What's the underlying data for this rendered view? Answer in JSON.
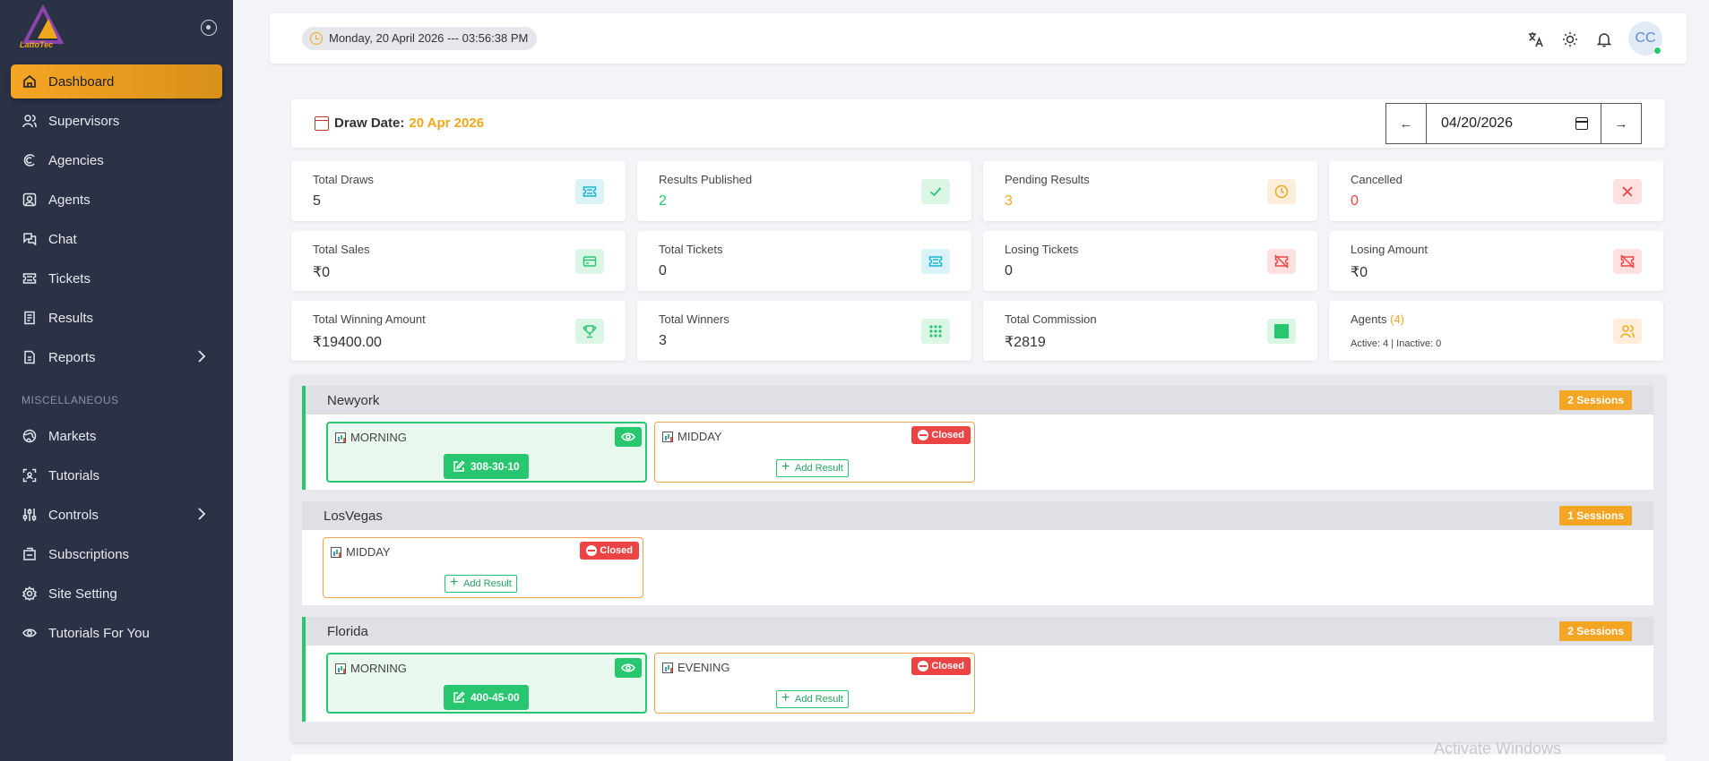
{
  "app": {
    "logo_text": "LattoTec"
  },
  "sidebar": {
    "items": [
      {
        "label": "Dashboard",
        "icon": "home-icon",
        "active": true
      },
      {
        "label": "Supervisors",
        "icon": "users-icon"
      },
      {
        "label": "Agencies",
        "icon": "agency-icon"
      },
      {
        "label": "Agents",
        "icon": "agent-icon"
      },
      {
        "label": "Chat",
        "icon": "chat-icon"
      },
      {
        "label": "Tickets",
        "icon": "ticket-icon"
      },
      {
        "label": "Results",
        "icon": "document-icon"
      },
      {
        "label": "Reports",
        "icon": "reports-icon",
        "expandable": true
      }
    ],
    "section_label": "MISCELLANEOUS",
    "misc_items": [
      {
        "label": "Markets",
        "icon": "globe-icon"
      },
      {
        "label": "Tutorials",
        "icon": "tutorial-icon"
      },
      {
        "label": "Controls",
        "icon": "sliders-icon",
        "expandable": true
      },
      {
        "label": "Subscriptions",
        "icon": "subscription-icon"
      },
      {
        "label": "Site Setting",
        "icon": "gear-icon"
      },
      {
        "label": "Tutorials For You",
        "icon": "eye-icon"
      }
    ]
  },
  "topbar": {
    "datetime": "Monday, 20 April 2026 --- 03:56:38 PM",
    "avatar_initials": "CC"
  },
  "draw": {
    "label": "Draw Date:",
    "value": "20 Apr 2026",
    "prev": "←",
    "next": "→",
    "input_value": "04/20/2026"
  },
  "stats": [
    {
      "title": "Total Draws",
      "value": "5",
      "value_color": "#333333",
      "icon": "ticket-icon",
      "badge_bg": "#d9f3f8",
      "icon_color": "#19b4d1"
    },
    {
      "title": "Results Published",
      "value": "2",
      "value_color": "#28c76f",
      "icon": "check-icon",
      "badge_bg": "#dcf6e6",
      "icon_color": "#28c76f"
    },
    {
      "title": "Pending Results",
      "value": "3",
      "value_color": "#f0a81b",
      "icon": "clock-icon",
      "badge_bg": "#fdeedb",
      "icon_color": "#f0a81b"
    },
    {
      "title": "Cancelled",
      "value": "0",
      "value_color": "#ea4444",
      "icon": "x-icon",
      "badge_bg": "#fde1e1",
      "icon_color": "#ea4444"
    },
    {
      "title": "Total Sales",
      "value": "₹0",
      "value_color": "#333333",
      "icon": "card-icon",
      "badge_bg": "#dcf6e6",
      "icon_color": "#28c76f"
    },
    {
      "title": "Total Tickets",
      "value": "0",
      "value_color": "#333333",
      "icon": "ticket-icon",
      "badge_bg": "#d9f3f8",
      "icon_color": "#19b4d1"
    },
    {
      "title": "Losing Tickets",
      "value": "0",
      "value_color": "#333333",
      "icon": "ticket-off-icon",
      "badge_bg": "#fde1e1",
      "icon_color": "#ea4444"
    },
    {
      "title": "Losing Amount",
      "value": "₹0",
      "value_color": "#333333",
      "icon": "ticket-off-icon",
      "badge_bg": "#fde1e1",
      "icon_color": "#ea4444"
    },
    {
      "title": "Total Winning Amount",
      "value": "₹19400.00",
      "value_color": "#333333",
      "icon": "trophy-icon",
      "badge_bg": "#dcf6e6",
      "icon_color": "#28c76f"
    },
    {
      "title": "Total Winners",
      "value": "3",
      "value_color": "#333333",
      "icon": "grid-icon",
      "badge_bg": "#dcf6e6",
      "icon_color": "#28c76f"
    },
    {
      "title": "Total Commission",
      "value": "₹2819",
      "value_color": "#333333",
      "icon": "square-icon",
      "badge_bg": "#dcf6e6",
      "icon_color": "#28c76f"
    }
  ],
  "agents_card": {
    "title": "Agents",
    "count": "(4)",
    "sub": "Active: 4 | Inactive: 0",
    "icon": "users-icon",
    "badge_bg": "#fdeedb",
    "icon_color": "#f0a81b"
  },
  "markets": [
    {
      "name": "Newyork",
      "badge": "2 Sessions",
      "sessions": [
        {
          "name": "MORNING",
          "status": "done",
          "result": "308-30-10"
        },
        {
          "name": "MIDDAY",
          "status": "closed",
          "closed_label": "Closed",
          "action": "Add Result"
        }
      ]
    },
    {
      "name": "LosVegas",
      "badge": "1 Sessions",
      "sessions": [
        {
          "name": "MIDDAY",
          "status": "closed",
          "closed_label": "Closed",
          "action": "Add Result"
        }
      ]
    },
    {
      "name": "Florida",
      "badge": "2 Sessions",
      "sessions": [
        {
          "name": "MORNING",
          "status": "done",
          "result": "400-45-00"
        },
        {
          "name": "EVENING",
          "status": "closed",
          "closed_label": "Closed",
          "action": "Add Result"
        }
      ]
    }
  ],
  "watermark": "Activate Windows"
}
